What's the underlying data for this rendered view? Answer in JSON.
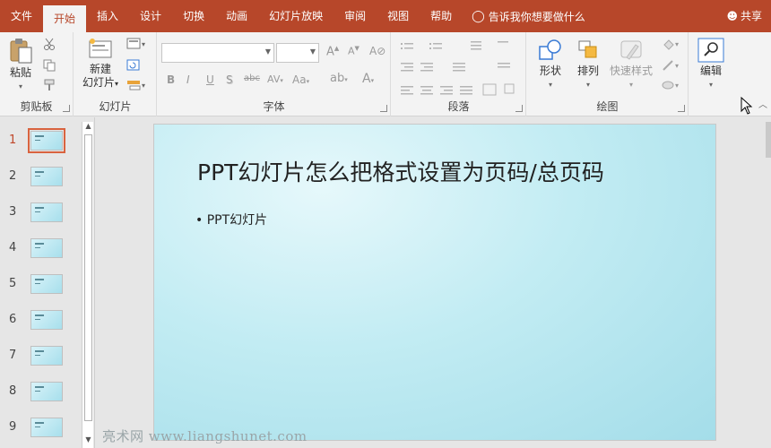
{
  "tabs": [
    {
      "label": "文件"
    },
    {
      "label": "开始"
    },
    {
      "label": "插入"
    },
    {
      "label": "设计"
    },
    {
      "label": "切换"
    },
    {
      "label": "动画"
    },
    {
      "label": "幻灯片放映"
    },
    {
      "label": "审阅"
    },
    {
      "label": "视图"
    },
    {
      "label": "帮助"
    }
  ],
  "tell_me": "告诉我你想要做什么",
  "share": "共享",
  "ribbon": {
    "clipboard": {
      "paste": "粘贴",
      "label": "剪贴板"
    },
    "slides": {
      "new_slide_line1": "新建",
      "new_slide_line2": "幻灯片",
      "label": "幻灯片"
    },
    "font": {
      "bold": "B",
      "italic": "I",
      "underline": "U",
      "shadow": "S",
      "strike": "abc",
      "case": "Aa",
      "label": "字体"
    },
    "paragraph": {
      "label": "段落"
    },
    "drawing": {
      "shapes": "形状",
      "arrange": "排列",
      "quick_styles": "快速样式",
      "label": "绘图"
    },
    "editing": {
      "label": "编辑"
    }
  },
  "thumbnails": [
    {
      "num": "1",
      "selected": true
    },
    {
      "num": "2",
      "selected": false
    },
    {
      "num": "3",
      "selected": false
    },
    {
      "num": "4",
      "selected": false
    },
    {
      "num": "5",
      "selected": false
    },
    {
      "num": "6",
      "selected": false
    },
    {
      "num": "7",
      "selected": false
    },
    {
      "num": "8",
      "selected": false
    },
    {
      "num": "9",
      "selected": false
    }
  ],
  "slide": {
    "title": "PPT幻灯片怎么把格式设置为页码/总页码",
    "bullet": "• PPT幻灯片"
  },
  "watermark": "亮术网 www.liangshunet.com",
  "colors": {
    "accent": "#b7472a",
    "ribbon_bg": "#f3f3f3",
    "selected_thumb": "#d9633f"
  }
}
